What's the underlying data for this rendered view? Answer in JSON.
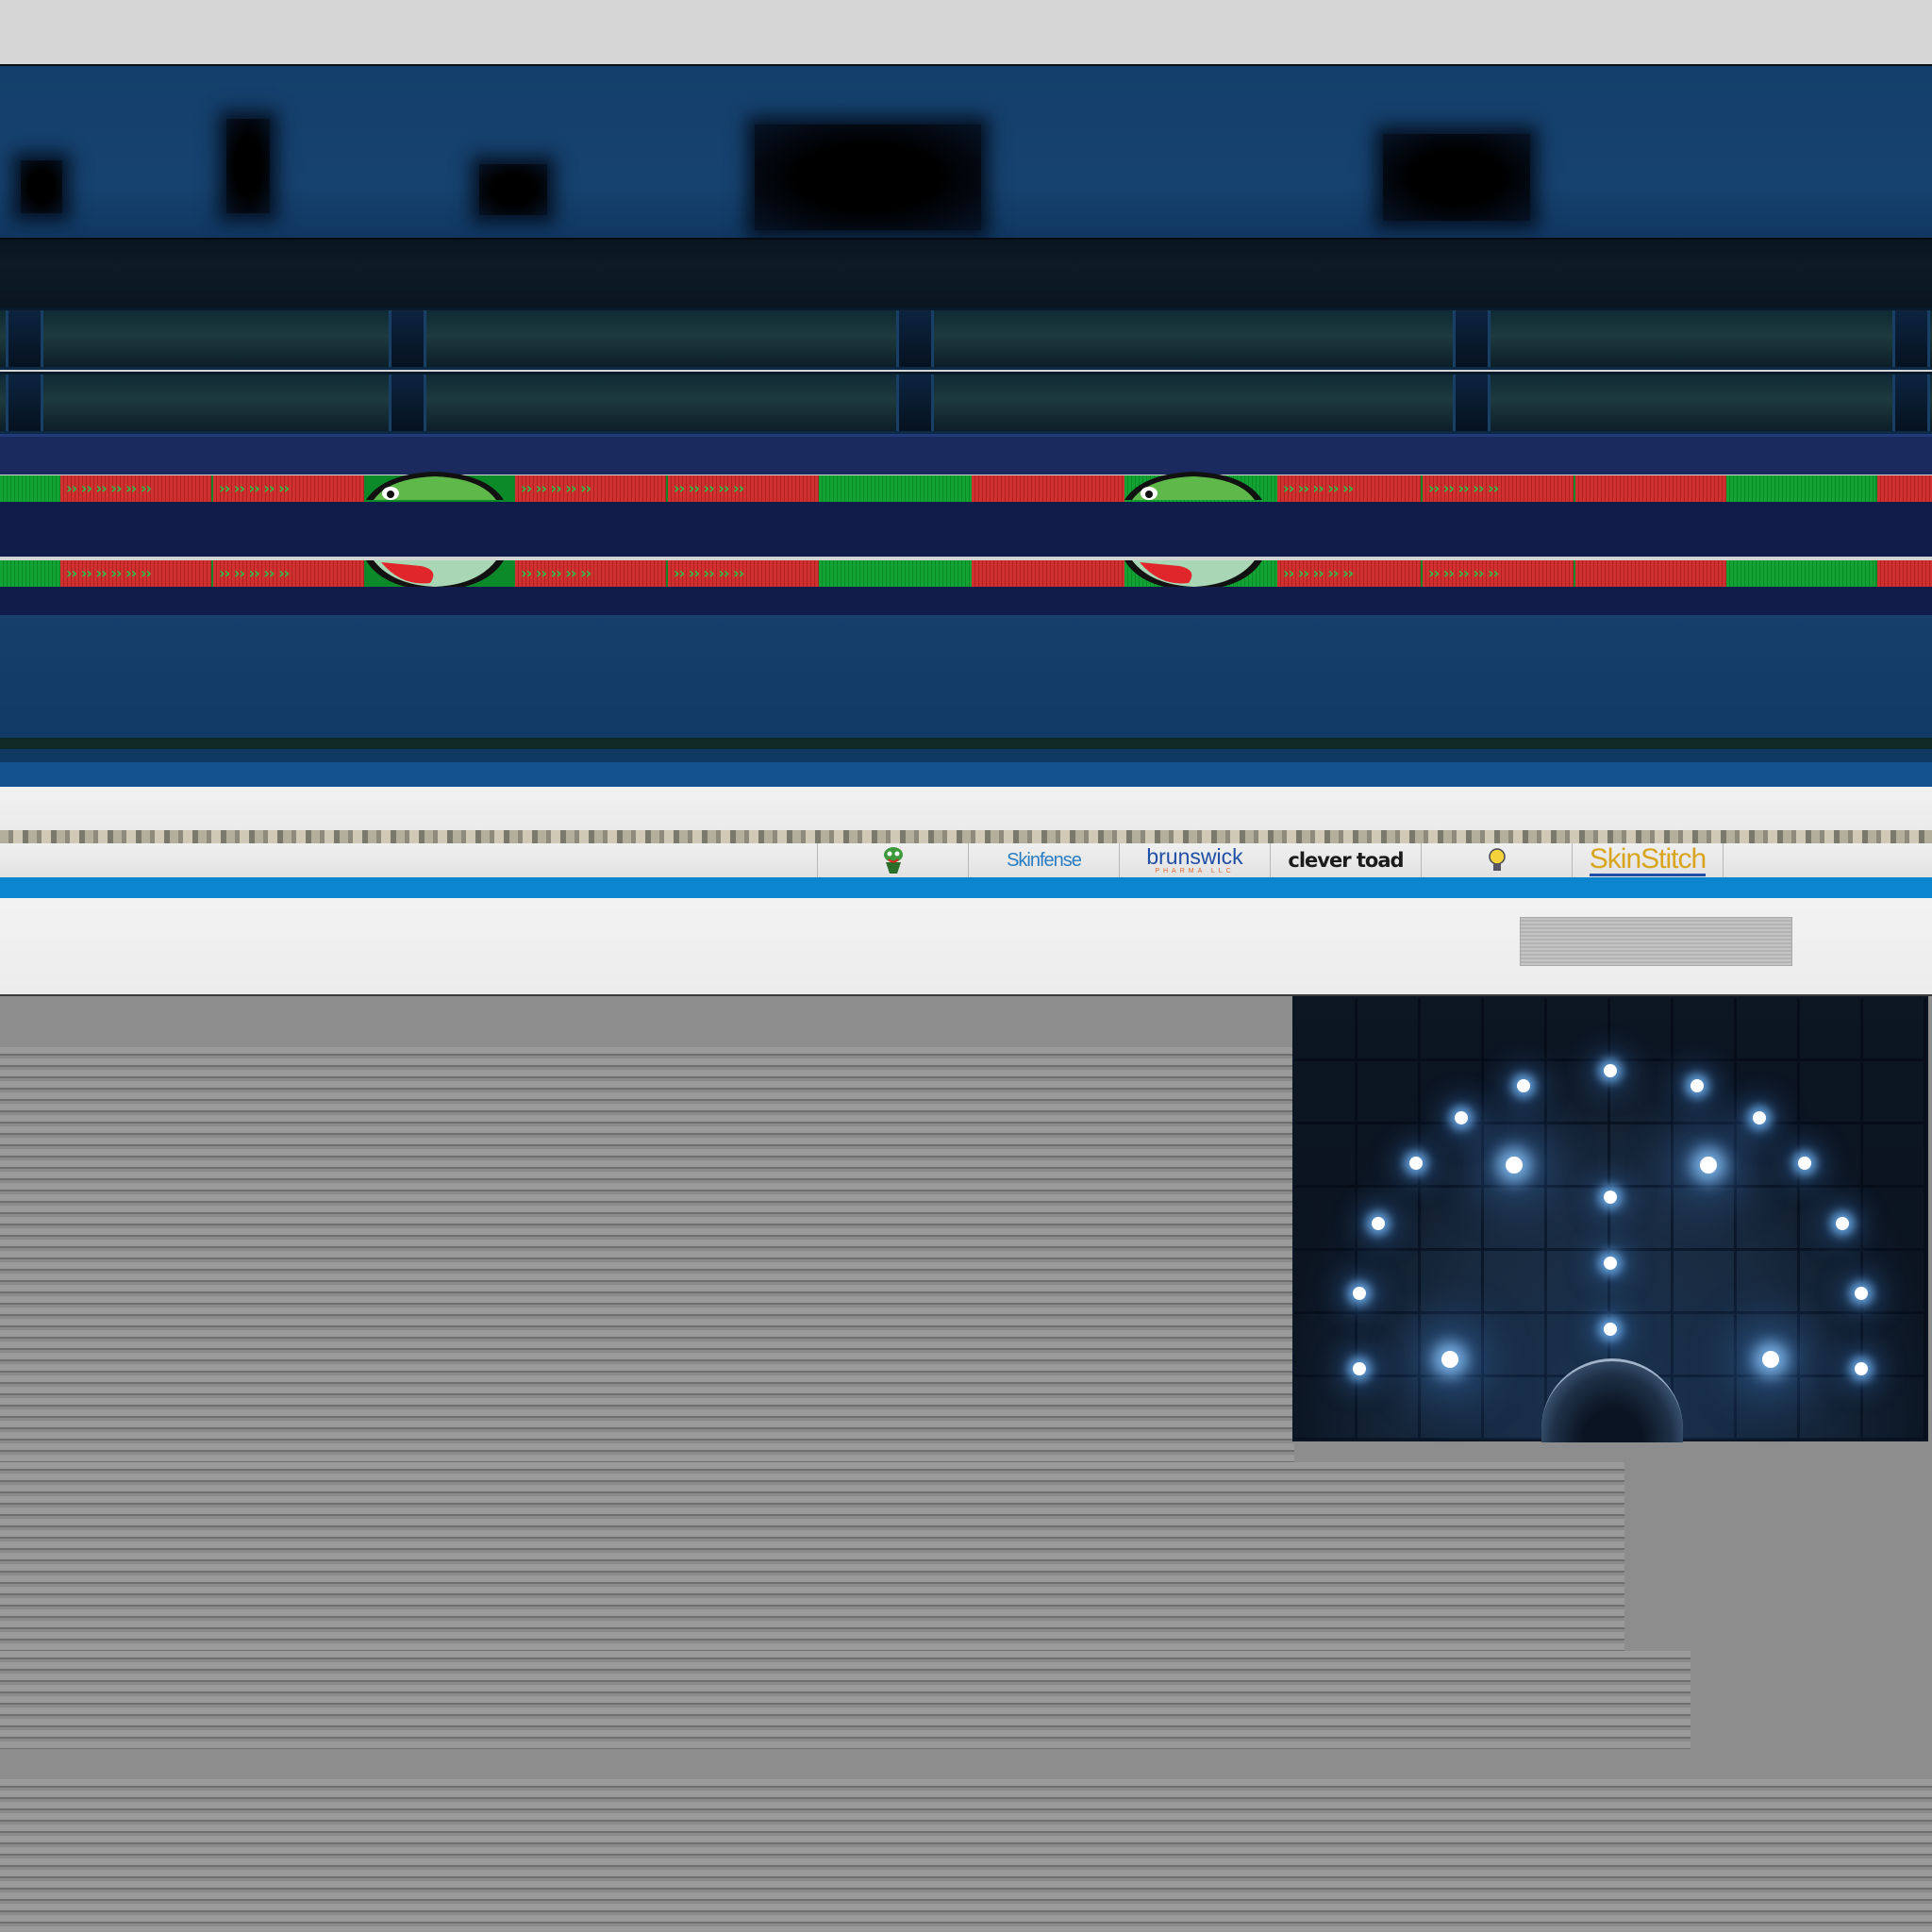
{
  "scene": {
    "palette": {
      "top_strip": "#d6d6d6",
      "arena_wall_blue": "#16426f",
      "led_green": "#12a334",
      "led_red": "#d03030",
      "accent_blue_rule": "#0c85cf",
      "concrete": "#8d8d8d",
      "tunnel_panel": "#1d3047"
    },
    "led_boards": [
      {
        "row": "upper",
        "mascot_part": "gator-head-top"
      },
      {
        "row": "lower",
        "mascot_part": "gator-mouth-bottom"
      }
    ]
  },
  "sponsors": [
    {
      "name": "gator-mascot-logo",
      "label": ""
    },
    {
      "name": "skinfense",
      "label": "Skinfense"
    },
    {
      "name": "brunswick",
      "label": "brunswick",
      "sublabel": "PHARMA LLC"
    },
    {
      "name": "clever-toad",
      "label": "clever toad"
    },
    {
      "name": "bulb-logo",
      "label": ""
    },
    {
      "name": "skinstitch",
      "label": "SkinStitch"
    }
  ]
}
